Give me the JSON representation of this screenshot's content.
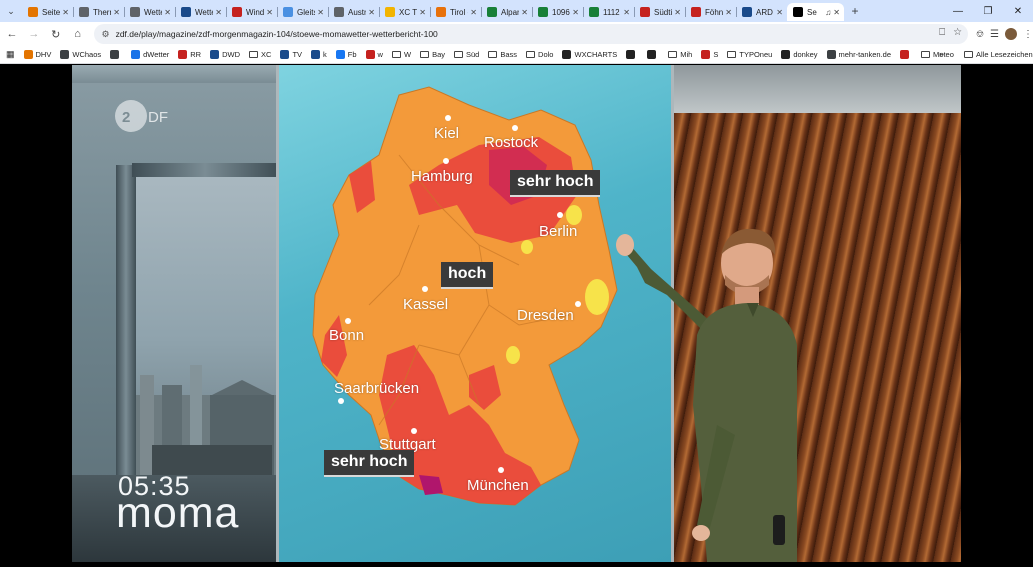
{
  "browser": {
    "tabs": [
      {
        "label": "Seiter",
        "color": "#e37400"
      },
      {
        "label": "Therm",
        "color": "#5f6368"
      },
      {
        "label": "Wette",
        "color": "#5f6368"
      },
      {
        "label": "Wette",
        "color": "#1a4a8a"
      },
      {
        "label": "Windy",
        "color": "#c5221f"
      },
      {
        "label": "Gleits",
        "color": "#4a90e2"
      },
      {
        "label": "Austr",
        "color": "#5f6368"
      },
      {
        "label": "XC Th",
        "color": "#f2b400"
      },
      {
        "label": "Tirol -",
        "color": "#e8710a"
      },
      {
        "label": "Alparc",
        "color": "#188038"
      },
      {
        "label": "1096",
        "color": "#188038"
      },
      {
        "label": "1112",
        "color": "#188038"
      },
      {
        "label": "Südti",
        "color": "#c5221f"
      },
      {
        "label": "Föhn",
        "color": "#c5221f"
      },
      {
        "label": "ARD",
        "color": "#1a4a8a"
      },
      {
        "label": "Se",
        "color": "#000000"
      }
    ],
    "url": "zdf.de/play/magazine/zdf-morgenmagazin-104/stoewe-momawetter-wetterbericht-100",
    "bookmarks": [
      {
        "label": "DHV",
        "color": "#e37400"
      },
      {
        "label": "WChaos",
        "color": "#3c4043"
      },
      {
        "label": "",
        "color": "#3c4043"
      },
      {
        "label": "dWetter",
        "color": "#1a73e8"
      },
      {
        "label": "RR",
        "color": "#c5221f"
      },
      {
        "label": "DWD",
        "color": "#1a4a8a"
      },
      {
        "label": "XC",
        "folder": true
      },
      {
        "label": "TV",
        "color": "#1a4a8a"
      },
      {
        "label": "k",
        "color": "#1a4a8a"
      },
      {
        "label": "Fb",
        "color": "#1877f2"
      },
      {
        "label": "w",
        "color": "#c5221f"
      },
      {
        "label": "W",
        "folder": true
      },
      {
        "label": "Bay",
        "folder": true
      },
      {
        "label": "Süd",
        "folder": true
      },
      {
        "label": "Bass",
        "folder": true
      },
      {
        "label": "Dolo",
        "folder": true
      },
      {
        "label": "WXCHARTS",
        "color": "#222222"
      },
      {
        "label": "",
        "color": "#222222"
      },
      {
        "label": "",
        "color": "#222222"
      },
      {
        "label": "Mih",
        "folder": true
      },
      {
        "label": "S",
        "color": "#c5221f"
      },
      {
        "label": "TYPOneu",
        "folder": true
      },
      {
        "label": "donkey",
        "color": "#222222"
      },
      {
        "label": "mehr-tanken.de",
        "color": "#3c4043"
      },
      {
        "label": "",
        "color": "#c5221f"
      },
      {
        "label": "Meteo",
        "folder": true
      }
    ],
    "all_bookmarks_label": "Alle Lesezeichen"
  },
  "video": {
    "channel_logo": "2DF",
    "time": "05:35",
    "show": "moma",
    "map": {
      "cities": [
        "Kiel",
        "Rostock",
        "Hamburg",
        "Berlin",
        "Kassel",
        "Dresden",
        "Bonn",
        "Saarbrücken",
        "Stuttgart",
        "München"
      ],
      "labels": [
        "sehr hoch",
        "hoch",
        "sehr hoch"
      ]
    }
  }
}
